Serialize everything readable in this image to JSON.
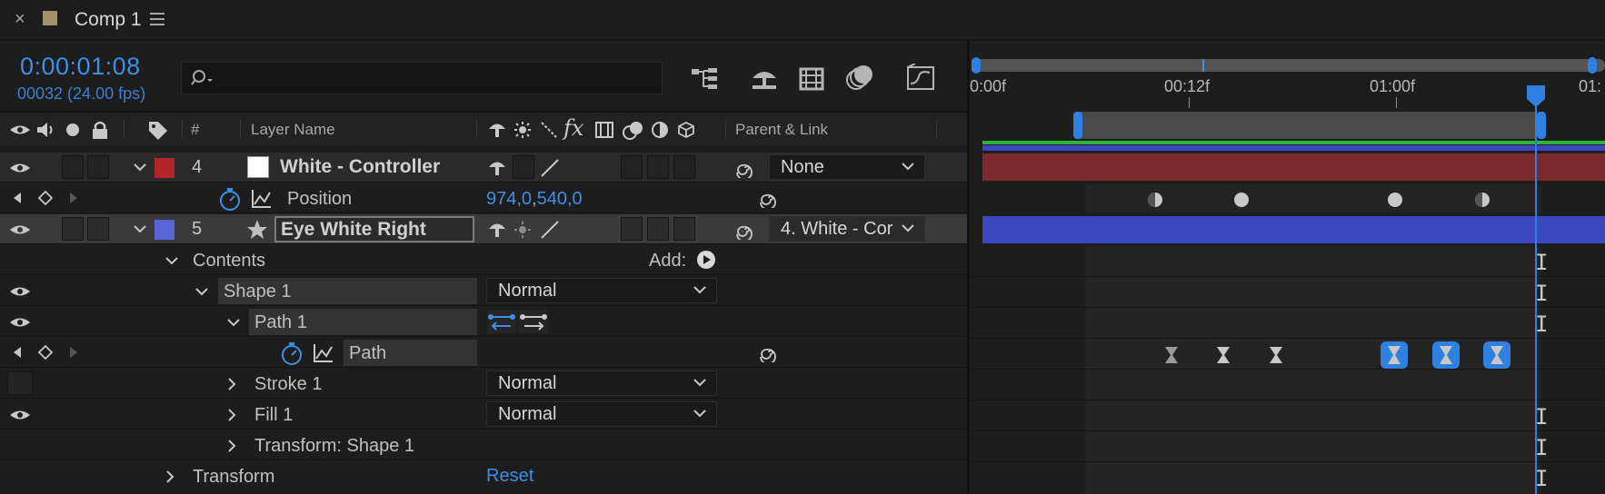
{
  "tab": {
    "title": "Comp 1"
  },
  "time": {
    "current": "0:00:01:08",
    "frames_fps": "00032 (24.00 fps)"
  },
  "search": {
    "placeholder": ""
  },
  "columns": {
    "number": "#",
    "layer_name": "Layer Name",
    "parent": "Parent & Link"
  },
  "ruler": {
    "labels": [
      "0:00f",
      "00:12f",
      "01:00f",
      "01:"
    ]
  },
  "layers": [
    {
      "index": "4",
      "name": "White - Controller",
      "label_color": "#b2262a",
      "parent": "None"
    },
    {
      "index": "5",
      "name": "Eye White Right",
      "label_color": "#5a66d6",
      "parent": "4. White - Cor"
    }
  ],
  "position": {
    "label": "Position",
    "value_x": "974,0",
    "sep": ",",
    "value_y": "540,0"
  },
  "contents": {
    "label": "Contents",
    "add_label": "Add:"
  },
  "shape1": {
    "label": "Shape 1",
    "blend": "Normal"
  },
  "path1": {
    "label": "Path 1"
  },
  "path": {
    "label": "Path"
  },
  "stroke1": {
    "label": "Stroke 1",
    "blend": "Normal"
  },
  "fill1": {
    "label": "Fill 1",
    "blend": "Normal"
  },
  "transform_shape": {
    "label": "Transform: Shape 1"
  },
  "transform": {
    "label": "Transform",
    "reset": "Reset"
  },
  "colors": {
    "accent": "#3d8fe6",
    "layer4_bar": "#7a2a2c",
    "layer5_bar": "#3b47bf",
    "work_area": "#2fb33a"
  }
}
